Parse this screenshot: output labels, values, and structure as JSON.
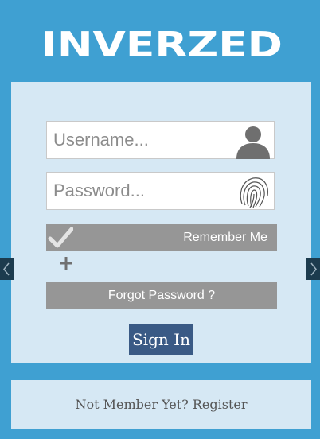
{
  "brand": {
    "name": "INVERZED"
  },
  "login": {
    "username_placeholder": "Username...",
    "password_placeholder": "Password...",
    "remember_label": "Remember Me",
    "forgot_label": "Forgot Password ?",
    "signin_label": "Sign In"
  },
  "footer": {
    "register_text": "Not Member Yet? Register"
  },
  "icons": {
    "user": "user-icon",
    "fingerprint": "fingerprint-icon",
    "check": "check-icon",
    "plus": "plus-icon",
    "prev": "chevron-left-icon",
    "next": "chevron-right-icon"
  },
  "colors": {
    "background": "#3fa0d2",
    "card": "#d6e8f4",
    "gray_button": "#969696",
    "signin_button": "#3a5a85",
    "slider_arrow": "#1c3b4e"
  }
}
